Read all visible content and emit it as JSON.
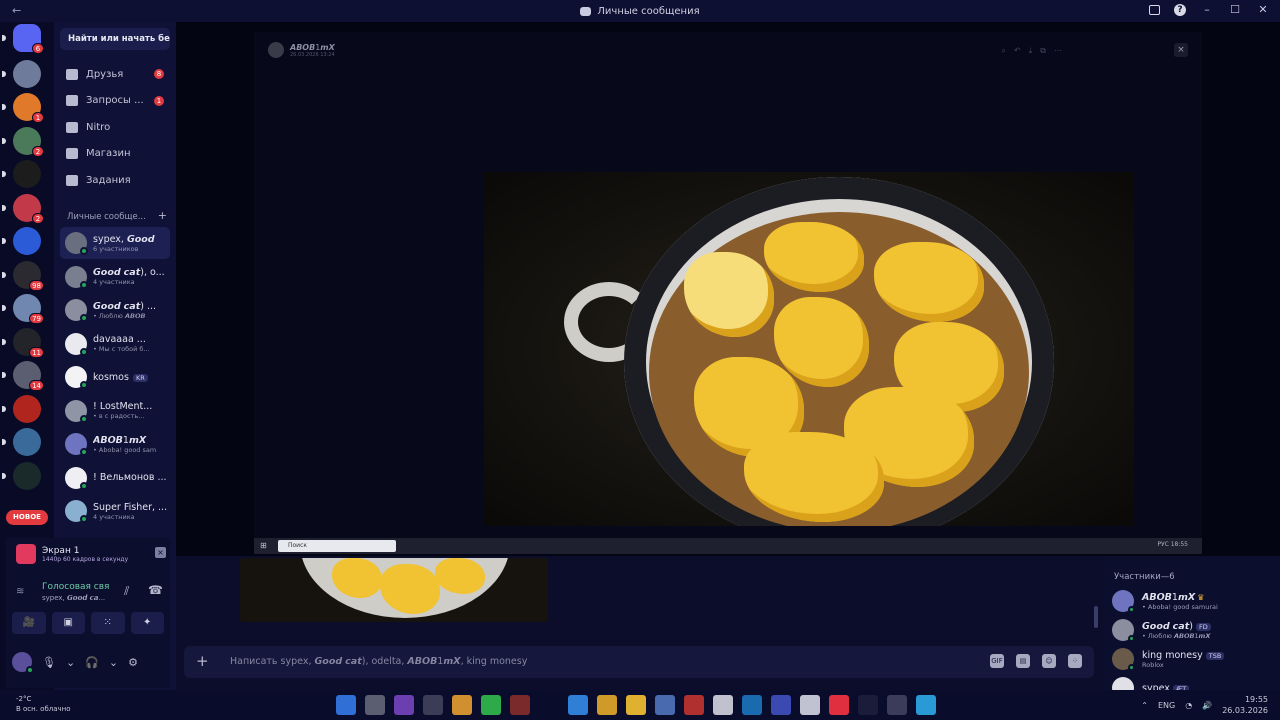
{
  "window": {
    "title": "Личные сообщения",
    "back": "←"
  },
  "servers": [
    {
      "badge": "6",
      "color": "#5865f2"
    },
    {
      "badge": "",
      "color": "#6f7b9a"
    },
    {
      "badge": "1",
      "color": "#e07a2a"
    },
    {
      "badge": "2",
      "color": "#4a7a5a"
    },
    {
      "badge": "",
      "color": "#1c1c1c"
    },
    {
      "badge": "2",
      "color": "#c23a4a"
    },
    {
      "badge": "",
      "color": "#2b5bd6"
    },
    {
      "badge": "98",
      "color": "#2a2a30"
    },
    {
      "badge": "79",
      "color": "#7088b0"
    },
    {
      "badge": "11",
      "color": "#22242a"
    },
    {
      "badge": "14",
      "color": "#5b5e70"
    },
    {
      "badge": "",
      "color": "#b0261e"
    },
    {
      "badge": "",
      "color": "#3a6a9a"
    },
    {
      "badge": "",
      "color": "#1a2a2a"
    }
  ],
  "new_pill": "НОВОЕ",
  "sidebar": {
    "search": "Найти или начать бе...",
    "nav": [
      {
        "label": "Друзья",
        "badge": "8"
      },
      {
        "label": "Запросы ...",
        "badge": "1"
      },
      {
        "label": "Nitro",
        "badge": ""
      },
      {
        "label": "Магазин",
        "badge": ""
      },
      {
        "label": "Задания",
        "badge": ""
      }
    ],
    "dm_header": "Личные сообще...",
    "dm_plus": "+",
    "dms": [
      {
        "name": "sypex, 𝙂𝙤𝙤𝙙",
        "sub": "6 участников",
        "tag": "",
        "color": "#6a6f80",
        "active": true
      },
      {
        "name": "𝙂𝙤𝙤𝙙 𝙘𝙖𝙩), o...",
        "sub": "4 участника",
        "tag": "",
        "color": "#7a7f90",
        "active": false
      },
      {
        "name": "𝙂𝙤𝙤𝙙 𝙘𝙖𝙩) ...",
        "sub": "• Люблю 𝘼𝘽𝙊𝘽",
        "tag": "",
        "color": "#8a8e9e",
        "active": false
      },
      {
        "name": "davaaaa ...",
        "sub": "• Мы с тобой б...",
        "tag": "",
        "color": "#e9e9ef",
        "active": false
      },
      {
        "name": "kosmos",
        "sub": "",
        "tag": "KR",
        "color": "#f3f3f6",
        "active": false
      },
      {
        "name": "! LostMent...",
        "sub": "• в с радость...",
        "tag": "",
        "color": "#9095a6",
        "active": false
      },
      {
        "name": "𝘼𝘽𝙊𝘽1𝙢𝙓",
        "sub": "• Aboba! good sam",
        "tag": "",
        "color": "#6f74c0",
        "active": false
      },
      {
        "name": "! Вельмонов ...",
        "sub": "",
        "tag": "",
        "color": "#efeff3",
        "active": false
      },
      {
        "name": "Super Fisher, ...",
        "sub": "4 участника",
        "tag": "",
        "color": "#8ab0d0",
        "active": false
      }
    ]
  },
  "panel": {
    "screen_title": "Экран 1",
    "screen_sub": "1440p 60 кадров в секунду",
    "voice_title": "Голосовая свя",
    "voice_sub": "sypex, 𝙂𝙤𝙤𝙙 𝙘𝙖...",
    "buttons": [
      "🎥",
      "▣",
      "⁙",
      "✦"
    ]
  },
  "stage": {
    "user": "𝘼𝘽𝙊𝘽1𝙢𝙓",
    "date": "26.03.2026 13:24",
    "close": "×",
    "search_placeholder": "Поиск",
    "clock": "РУС 18:55"
  },
  "chat": {
    "placeholder": "Написать sypex, 𝙂𝙤𝙤𝙙 𝙘𝙖𝙩), odelta, 𝘼𝘽𝙊𝘽1𝙢𝙓, king monesy",
    "plus": "+",
    "icons": [
      "GIF",
      "▤",
      "☺",
      "⁘"
    ]
  },
  "members": {
    "header": "Участники—6",
    "list": [
      {
        "name": "𝘼𝘽𝙊𝘽1𝙢𝙓",
        "sub": "• Aboba! good samurai",
        "tag": "",
        "crown": "♛",
        "color": "#6f74c0"
      },
      {
        "name": "𝙂𝙤𝙤𝙙 𝙘𝙖𝙩)",
        "sub": "• Люблю 𝘼𝘽𝙊𝘽1𝙢𝙓",
        "tag": "FD",
        "crown": "",
        "color": "#8a8e9e"
      },
      {
        "name": "king monesy",
        "sub": "Roblox",
        "tag": "TSB",
        "crown": "",
        "color": "#6a5a4a"
      },
      {
        "name": "sypex",
        "sub": "",
        "tag": "ÆT",
        "crown": "",
        "color": "#e0e0e6"
      }
    ]
  },
  "taskbar": {
    "temp": "-2°C",
    "weather": "В осн. облачно",
    "lang": "ENG",
    "time": "19:55",
    "date": "26.03.2026",
    "apps": [
      "#2f6fd6",
      "#5b5e70",
      "#6c3fb0",
      "#3a3d55",
      "#d09030",
      "#2faa4a",
      "#7a2a2a",
      "#0a0c2c",
      "#2f7fd6",
      "#d09a2a",
      "#e0b030",
      "#4a6ab0",
      "#b03030",
      "#c0c0cf",
      "#1a6ab0",
      "#3a4ab0",
      "#c0c2d2",
      "#e03040",
      "#1a1c3a",
      "#3a3c5a",
      "#2a9ad6"
    ]
  }
}
